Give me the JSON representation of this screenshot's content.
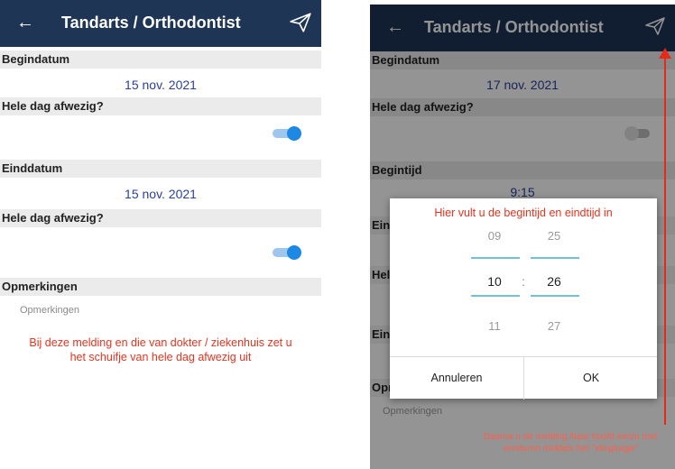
{
  "left": {
    "appbar": {
      "back_icon": "arrow-left-icon",
      "title": "Tandarts / Orthodontist",
      "send_icon": "send-paper-plane-icon"
    },
    "begindatum": {
      "label": "Begindatum",
      "value": "15 nov. 2021"
    },
    "hele_dag_1": {
      "label": "Hele dag afwezig?",
      "on": true
    },
    "einddatum": {
      "label": "Einddatum",
      "value": "15 nov. 2021"
    },
    "hele_dag_2": {
      "label": "Hele dag afwezig?",
      "on": true
    },
    "opmerkingen": {
      "label": "Opmerkingen",
      "placeholder": "Opmerkingen"
    },
    "note": "Bij deze melding en die van dokter / ziekenhuis zet u het schuifje van hele dag afwezig uit"
  },
  "right": {
    "appbar": {
      "back_icon": "arrow-left-icon",
      "title": "Tandarts / Orthodontist",
      "send_icon": "send-paper-plane-icon"
    },
    "begindatum": {
      "label": "Begindatum",
      "value": "17 nov. 2021"
    },
    "hele_dag": {
      "label": "Hele dag afwezig?",
      "on": false
    },
    "begintijd": {
      "label": "Begintijd",
      "value": "9:15"
    },
    "partial_labels": {
      "ein1": "Ein",
      "hel": "Hel",
      "ein2": "Ein",
      "opr": "Opr"
    },
    "opmerkingen_placeholder": "Opmerkingen",
    "dialog": {
      "title": "Hier vult u de begintijd en eindtijd in",
      "hours": {
        "prev": "09",
        "selected": "10",
        "next": "11"
      },
      "minutes": {
        "prev": "25",
        "selected": "26",
        "next": "27"
      },
      "separator": ":",
      "cancel": "Annuleren",
      "ok": "OK"
    },
    "hint": "Daarna u de melding Naar hoofd een/u met versturen middels het \"vliegtuigje\""
  },
  "colors": {
    "appbar": "#1e3555",
    "value_text": "#2b3f9e",
    "accent": "#1e88e5",
    "annotation": "#e53421"
  }
}
